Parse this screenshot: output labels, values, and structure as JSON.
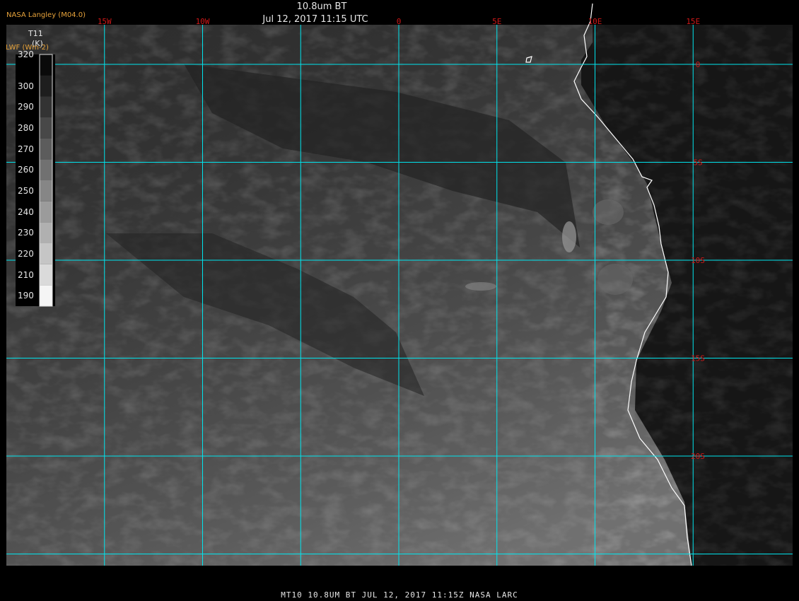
{
  "header": {
    "producer": "NASA Langley (M04.0)",
    "title": "10.8um BT",
    "datetime": "Jul 12, 2017 11:15 UTC"
  },
  "legend": {
    "variable": "T11",
    "unit": "(K)",
    "secondary": "LWF (Wm-2)",
    "ticks": [
      "320",
      "300",
      "290",
      "280",
      "270",
      "260",
      "250",
      "240",
      "230",
      "220",
      "210",
      "190"
    ],
    "colors": [
      "#0a0a0a",
      "#1e1e1e",
      "#333333",
      "#484848",
      "#5c5c5c",
      "#717171",
      "#868686",
      "#9b9b9b",
      "#b0b0b0",
      "#c5c5c5",
      "#dadada",
      "#f5f5f5"
    ]
  },
  "map": {
    "lon_labels": [
      "15W",
      "10W",
      "0",
      "5E",
      "10E",
      "15E"
    ],
    "lon_values": [
      -15,
      -10,
      0,
      5,
      10,
      15
    ],
    "lat_labels": [
      "0",
      "5S",
      "10S",
      "15S",
      "20S"
    ],
    "lat_values": [
      0,
      -5,
      -10,
      -15,
      -20
    ],
    "grid_color": "#00e5ee",
    "label_color": "#d01818",
    "coast_color": "#ffffff"
  },
  "footer": "MT10   10.8UM BT    JUL 12, 2017 11:15Z    NASA LARC"
}
